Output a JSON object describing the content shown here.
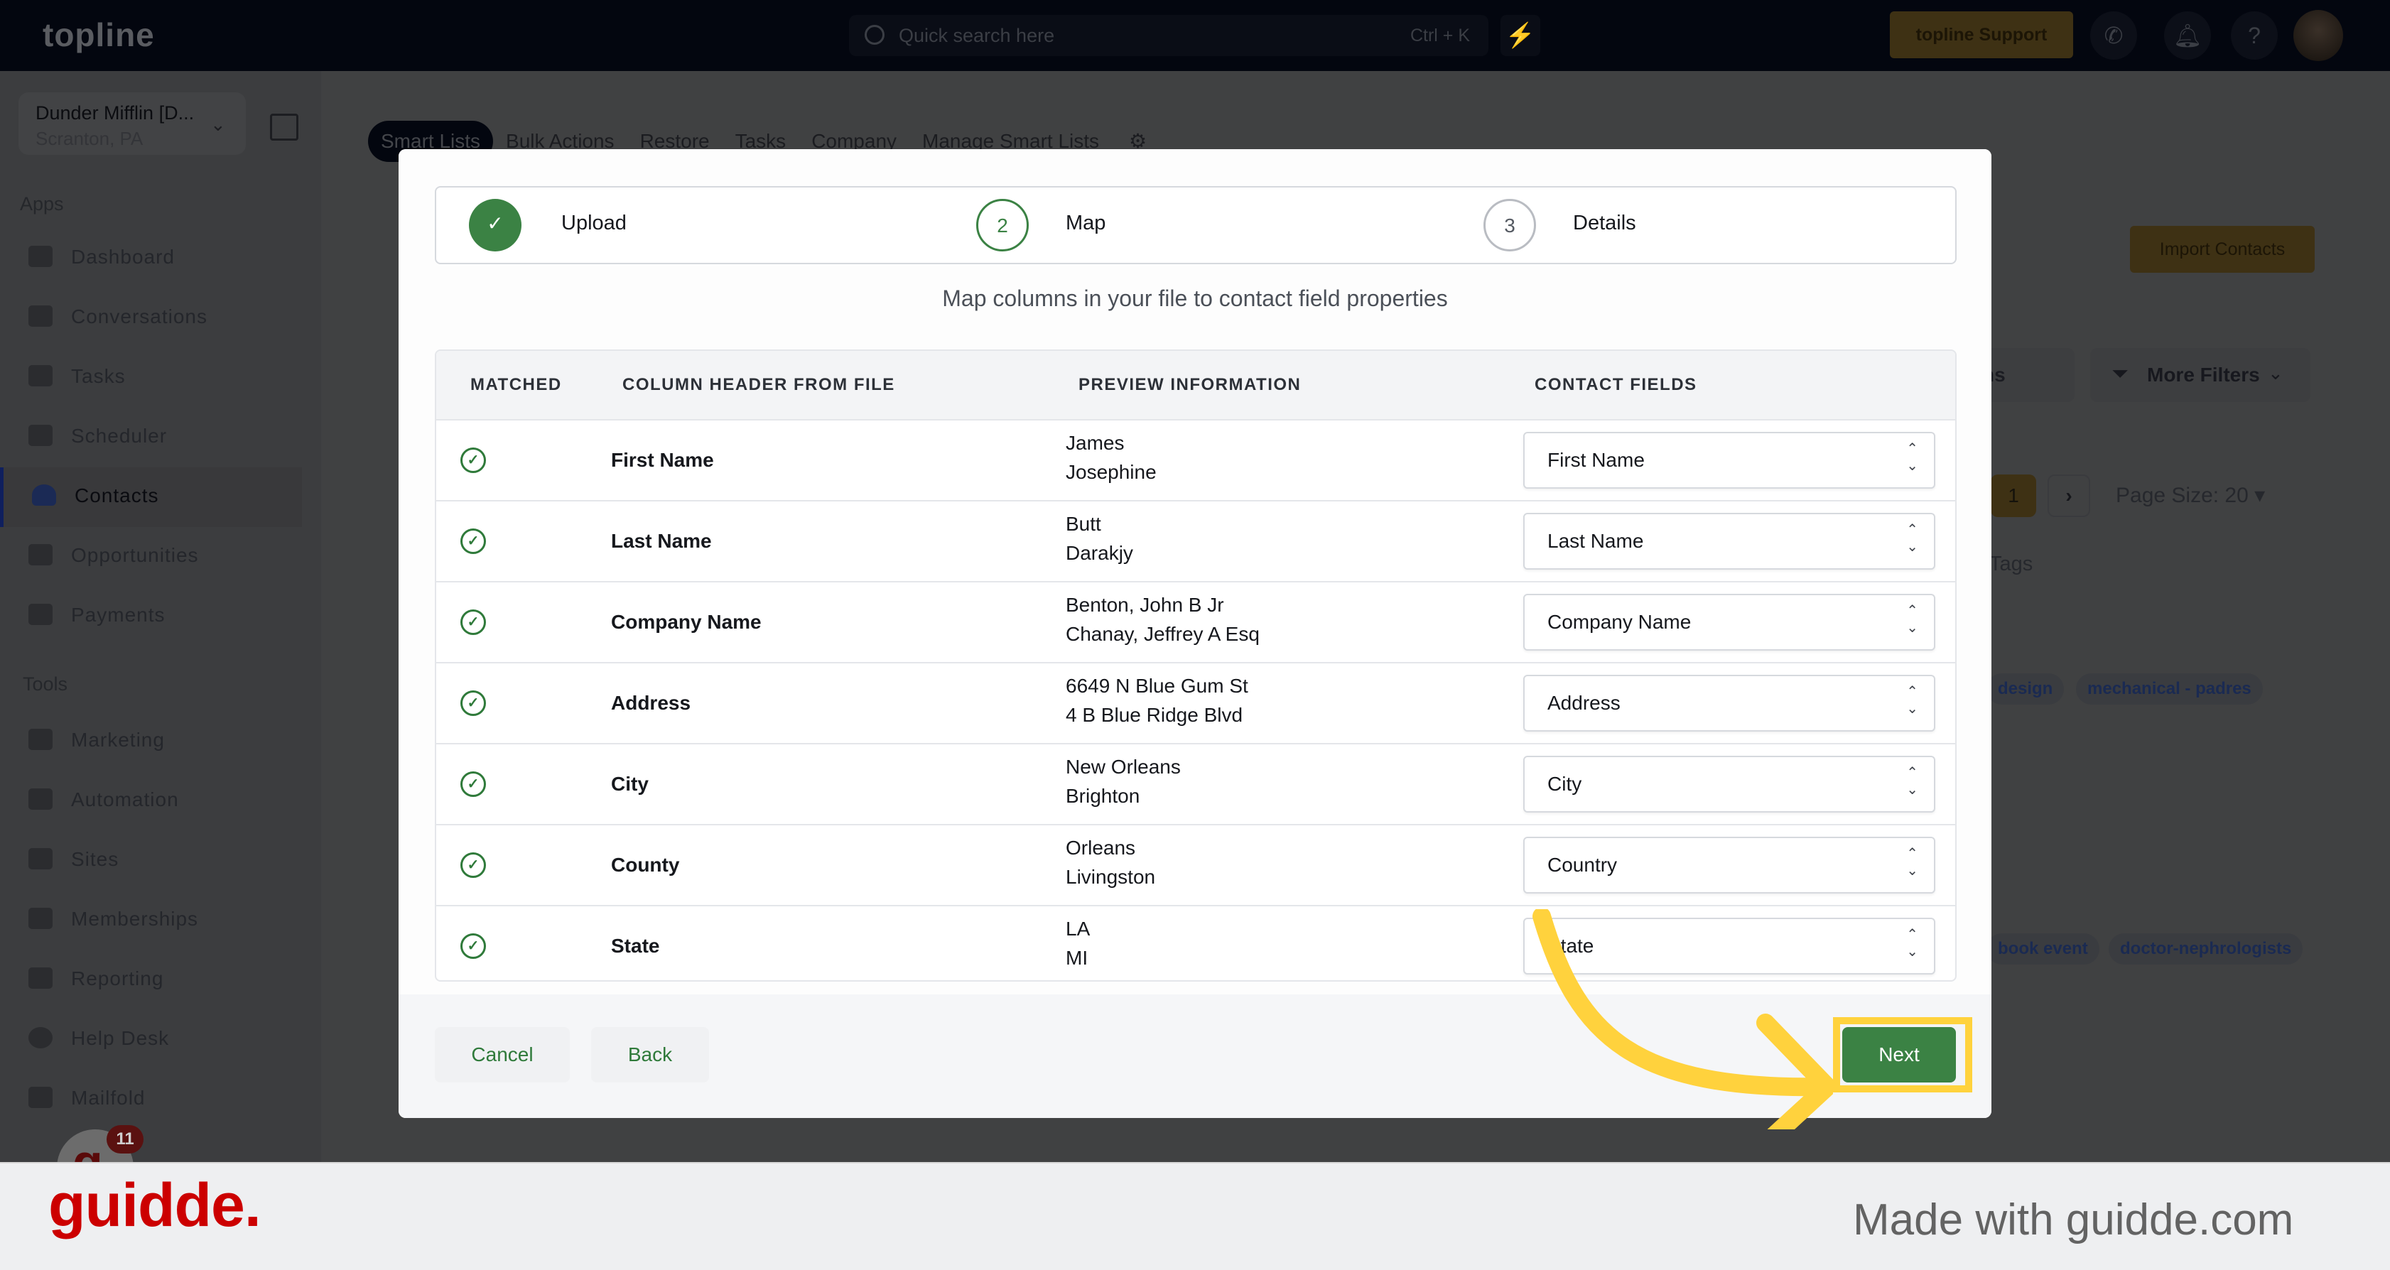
{
  "topbar": {
    "logo": "topline",
    "search_placeholder": "Quick search here",
    "search_shortcut": "Ctrl + K",
    "support_label": "topline Support",
    "icons": [
      "lightning-icon",
      "phone-icon",
      "bell-icon",
      "help-icon",
      "user-avatar"
    ]
  },
  "sidebar": {
    "account_name": "Dunder Mifflin [D...",
    "account_location": "Scranton, PA",
    "apps_label": "Apps",
    "tools_label": "Tools",
    "apps": [
      {
        "label": "Dashboard",
        "icon": "dashboard-icon"
      },
      {
        "label": "Conversations",
        "icon": "chat-icon"
      },
      {
        "label": "Tasks",
        "icon": "task-icon"
      },
      {
        "label": "Scheduler",
        "icon": "calendar-icon"
      },
      {
        "label": "Contacts",
        "icon": "person-icon",
        "active": true
      },
      {
        "label": "Opportunities",
        "icon": "target-icon"
      },
      {
        "label": "Payments",
        "icon": "credit-card-icon"
      }
    ],
    "tools": [
      {
        "label": "Marketing",
        "icon": "megaphone-icon"
      },
      {
        "label": "Automation",
        "icon": "gears-icon"
      },
      {
        "label": "Sites",
        "icon": "globe-icon"
      },
      {
        "label": "Memberships",
        "icon": "users-add-icon"
      },
      {
        "label": "Reporting",
        "icon": "pie-chart-icon"
      },
      {
        "label": "Help Desk",
        "icon": "help-circle-icon"
      },
      {
        "label": "Mailfold",
        "icon": "mail-icon"
      }
    ],
    "fab_badge": "11"
  },
  "main": {
    "tabs": [
      "Smart Lists",
      "Bulk Actions",
      "Restore",
      "Tasks",
      "Company",
      "Manage Smart Lists"
    ],
    "active_tab": "Smart Lists",
    "import_label": "Import Contacts",
    "columns_label": "ns",
    "more_filters_label": "More Filters",
    "current_page": "1",
    "page_size_label": "Page Size: 20",
    "tags_header": "Tags",
    "tags_row1": [
      "design",
      "mechanical - padres"
    ],
    "tags_row2": [
      "book event",
      "doctor-nephrologists"
    ]
  },
  "modal": {
    "steps": [
      {
        "number": "1",
        "label": "Upload",
        "status": "complete"
      },
      {
        "number": "2",
        "label": "Map",
        "status": "current"
      },
      {
        "number": "3",
        "label": "Details",
        "status": "upcoming"
      }
    ],
    "subtitle": "Map columns in your file to contact field properties",
    "columns": [
      "MATCHED",
      "COLUMN HEADER FROM FILE",
      "PREVIEW INFORMATION",
      "CONTACT FIELDS"
    ],
    "rows": [
      {
        "matched": true,
        "header": "First Name",
        "preview": [
          "James",
          "Josephine"
        ],
        "field": "First Name"
      },
      {
        "matched": true,
        "header": "Last Name",
        "preview": [
          "Butt",
          "Darakjy"
        ],
        "field": "Last Name"
      },
      {
        "matched": true,
        "header": "Company Name",
        "preview": [
          "Benton, John B Jr",
          "Chanay, Jeffrey A Esq"
        ],
        "field": "Company Name"
      },
      {
        "matched": true,
        "header": "Address",
        "preview": [
          "6649 N Blue Gum St",
          "4 B Blue Ridge Blvd"
        ],
        "field": "Address"
      },
      {
        "matched": true,
        "header": "City",
        "preview": [
          "New Orleans",
          "Brighton"
        ],
        "field": "City"
      },
      {
        "matched": true,
        "header": "County",
        "preview": [
          "Orleans",
          "Livingston"
        ],
        "field": "Country"
      },
      {
        "matched": true,
        "header": "State",
        "preview": [
          "LA",
          "MI"
        ],
        "field": "State"
      }
    ],
    "cancel_label": "Cancel",
    "back_label": "Back",
    "next_label": "Next"
  },
  "colors": {
    "accent_green": "#3b8244",
    "highlight_yellow": "#ffd23d",
    "brand_red": "#cc0000"
  },
  "footer": {
    "brand": "guidde.",
    "made_with": "Made with guidde.com"
  }
}
